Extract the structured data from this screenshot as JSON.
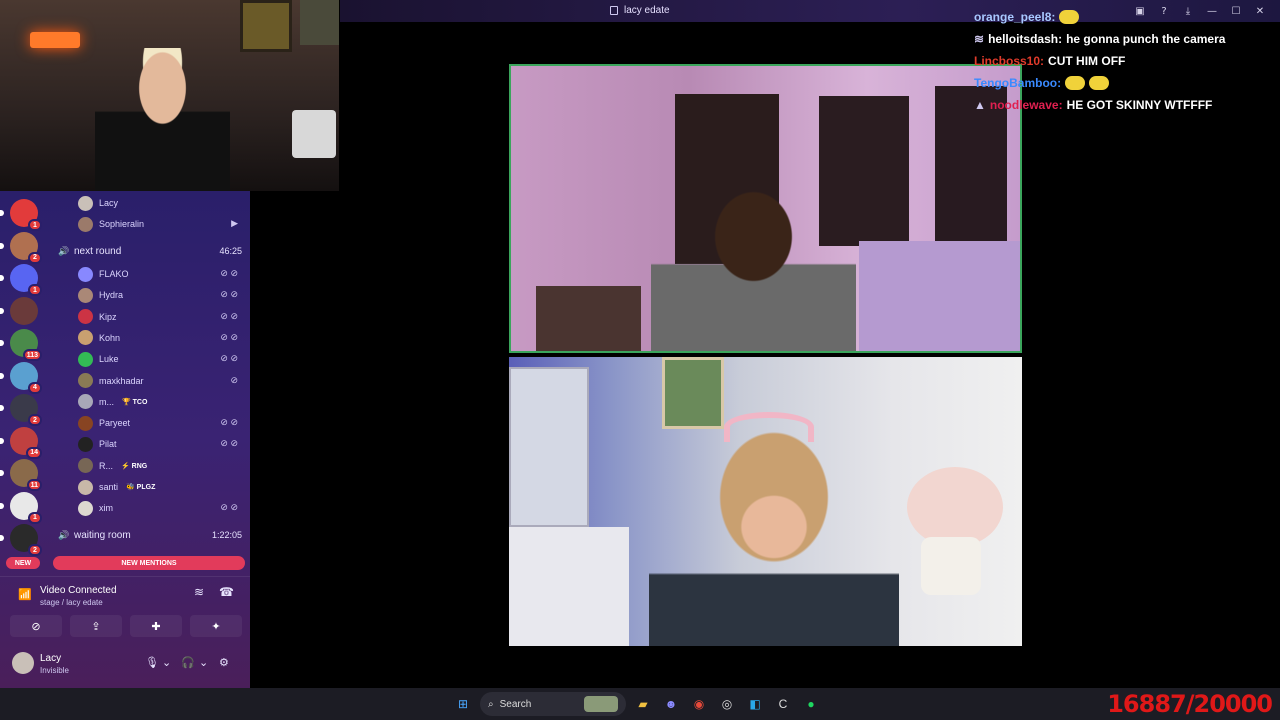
{
  "window": {
    "title": "lacy edate",
    "controls": [
      "▣",
      "?",
      "⤓",
      "—",
      "☐",
      "✕"
    ]
  },
  "voice": {
    "top_users": [
      {
        "name": "Lacy",
        "color": "#c9c0b8"
      },
      {
        "name": "Sophieralin",
        "color": "#9b7a6a"
      }
    ],
    "channel1": {
      "name": "next round",
      "time": "46:25"
    },
    "members": [
      {
        "name": "FLAKO",
        "tag": "",
        "color": "#8888ff"
      },
      {
        "name": "Hydra",
        "tag": "",
        "color": "#aa8877"
      },
      {
        "name": "Kipz",
        "tag": "",
        "color": "#cc3344"
      },
      {
        "name": "Kohn",
        "tag": "",
        "color": "#c9a070"
      },
      {
        "name": "Luke",
        "tag": "",
        "color": "#33bb55"
      },
      {
        "name": "maxkhadar",
        "tag": "",
        "color": "#8a7a55"
      },
      {
        "name": "m...",
        "tag": "🏆 TCO",
        "color": "#a8a8b8"
      },
      {
        "name": "Paryeet",
        "tag": "",
        "color": "#884422"
      },
      {
        "name": "Pilat",
        "tag": "",
        "color": "#222222"
      },
      {
        "name": "R...",
        "tag": "⚡ RNG",
        "color": "#776655"
      },
      {
        "name": "santi",
        "tag": "🐝 PLGZ",
        "color": "#c8b8a8"
      },
      {
        "name": "xim",
        "tag": "",
        "color": "#ddd8d0"
      }
    ],
    "channel2": {
      "name": "waiting room",
      "time": "1:22:05"
    },
    "new_label": "NEW",
    "mentions_label": "NEW MENTIONS",
    "connection_status": "Video Connected",
    "connection_sub": "stage / lacy edate",
    "user": {
      "name": "Lacy",
      "status": "Invisible"
    }
  },
  "servers": [
    {
      "badge": "1",
      "color": "#e23b3b"
    },
    {
      "badge": "2",
      "color": "#b07050"
    },
    {
      "badge": "1",
      "color": "#5865f2"
    },
    {
      "badge": "",
      "color": "#6a3a3a"
    },
    {
      "badge": "113",
      "color": "#4a8a4a"
    },
    {
      "badge": "4",
      "color": "#5aa0d0"
    },
    {
      "badge": "2",
      "color": "#3a3a4a"
    },
    {
      "badge": "14",
      "color": "#c04040"
    },
    {
      "badge": "11",
      "color": "#8a6a4a"
    },
    {
      "badge": "1",
      "color": "#e8e8e8"
    },
    {
      "badge": "2",
      "color": "#2a2a2a"
    }
  ],
  "chat": [
    {
      "user": "orange_peel8:",
      "color": "#a8c8ff",
      "message": "",
      "emotes": 1
    },
    {
      "user": "helloitsdash:",
      "color": "#ffffff",
      "message": "he gonna punch the camera",
      "emotes": 0,
      "prefix": "≋"
    },
    {
      "user": "Lincboss10:",
      "color": "#e23b2b",
      "message": "CUT HIM OFF",
      "emotes": 0
    },
    {
      "user": "TengoBamboo:",
      "color": "#3a8aff",
      "message": "",
      "emotes": 2
    },
    {
      "user": "noodlewave:",
      "color": "#e02050",
      "message": "HE GOT SKINNY WTFFFF",
      "emotes": 0,
      "prefix": "▲"
    }
  ],
  "taskbar": {
    "search_label": "Search",
    "counter": "16887/20000"
  }
}
